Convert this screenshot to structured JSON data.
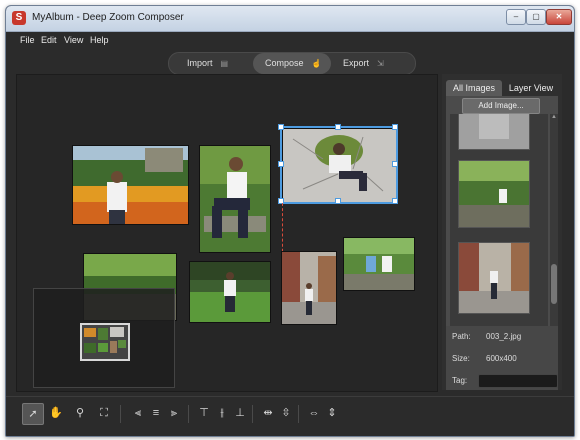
{
  "window": {
    "title": "MyAlbum - Deep Zoom Composer",
    "app_icon_glyph": "S",
    "controls": {
      "minimize": "–",
      "maximize": "▢",
      "close": "✕"
    }
  },
  "menu": [
    "File",
    "Edit",
    "View",
    "Help"
  ],
  "modes": [
    {
      "label": "Import",
      "icon": "import-icon",
      "active": false
    },
    {
      "label": "Compose",
      "icon": "compose-icon",
      "active": true
    },
    {
      "label": "Export",
      "icon": "export-icon",
      "active": false
    }
  ],
  "sidebar": {
    "tabs": [
      "All Images",
      "Layer View"
    ],
    "add_image_label": "Add Image...",
    "properties": [
      {
        "label": "Path:",
        "value": "003_2.jpg"
      },
      {
        "label": "Size:",
        "value": "600x400"
      },
      {
        "label": "Tag:",
        "value": ""
      }
    ]
  },
  "colors": {
    "selection": "#4d9be0",
    "guide": "#d84a3a",
    "background": "#2b2b2b"
  },
  "toolbar_icons": [
    "select-icon",
    "pan-hand-icon",
    "zoom-icon",
    "fit-view-icon",
    "align-left-icon",
    "align-center-icon",
    "align-right-icon",
    "align-top-icon",
    "align-middle-icon",
    "align-bottom-icon",
    "distribute-horizontal-icon",
    "distribute-vertical-icon",
    "same-width-icon",
    "same-height-icon"
  ]
}
